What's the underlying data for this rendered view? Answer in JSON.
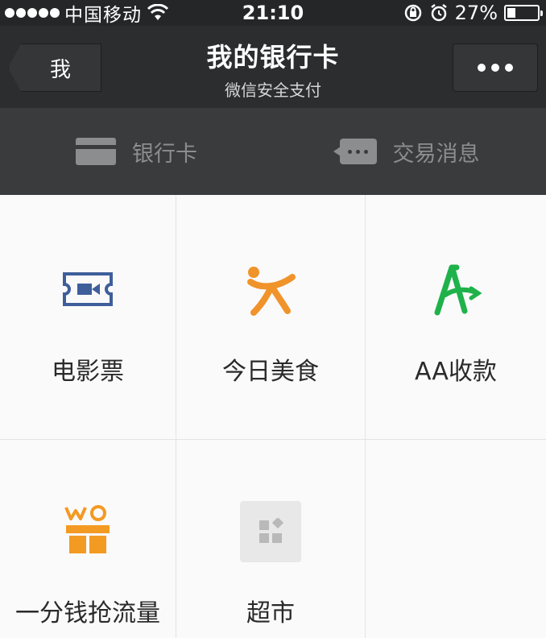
{
  "status_bar": {
    "carrier": "中国移动",
    "time": "21:10",
    "battery_text": "27%",
    "battery_level": 0.27
  },
  "nav": {
    "back_label": "我",
    "title": "我的银行卡",
    "subtitle": "微信安全支付",
    "more_icon": "more-dots-icon"
  },
  "tabs": [
    {
      "label": "银行卡",
      "icon": "bank-card-icon"
    },
    {
      "label": "交易消息",
      "icon": "message-icon"
    }
  ],
  "services": [
    {
      "label": "电影票",
      "icon": "movie-ticket-icon",
      "color": "#3f5f9b"
    },
    {
      "label": "今日美食",
      "icon": "food-person-icon",
      "color": "#f0932a"
    },
    {
      "label": "AA收款",
      "icon": "aa-collect-icon",
      "color": "#1fb24a"
    },
    {
      "label": "一分钱抢流量",
      "icon": "gift-box-icon",
      "color": "#f39a23"
    },
    {
      "label": "超市",
      "icon": "supermarket-icon",
      "color": "#b9b9b9"
    }
  ],
  "colors": {
    "nav_bg": "#2b2d2e",
    "tab_bg": "#3a3b3c",
    "grid_bg": "#fbfafb"
  }
}
